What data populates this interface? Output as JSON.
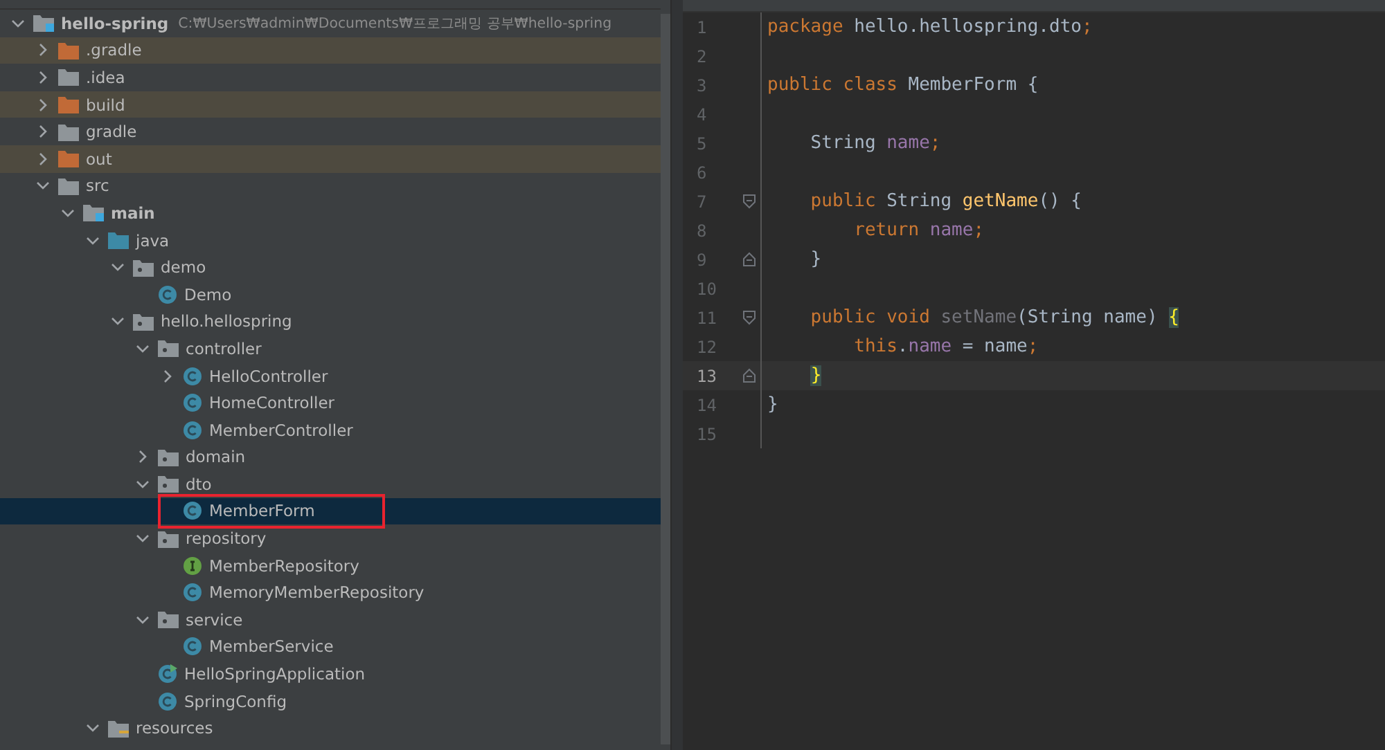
{
  "project_tree": [
    {
      "name": "hello-spring",
      "kind": "project",
      "path": "C:₩Users₩admin₩Documents₩프로그래밍 공부₩hello-spring",
      "expanded": true,
      "selected": false,
      "children": [
        {
          "name": ".gradle",
          "kind": "excluded",
          "expanded": false,
          "selected": false
        },
        {
          "name": ".idea",
          "kind": "folder",
          "expanded": false,
          "selected": false
        },
        {
          "name": "build",
          "kind": "excluded",
          "expanded": false,
          "selected": false
        },
        {
          "name": "gradle",
          "kind": "folder",
          "expanded": false,
          "selected": false
        },
        {
          "name": "out",
          "kind": "excluded",
          "expanded": false,
          "selected": false
        },
        {
          "name": "src",
          "kind": "folder",
          "expanded": true,
          "selected": false,
          "children": [
            {
              "name": "main",
              "kind": "module",
              "expanded": true,
              "selected": false,
              "children": [
                {
                  "name": "java",
                  "kind": "source",
                  "expanded": true,
                  "selected": false,
                  "children": [
                    {
                      "name": "demo",
                      "kind": "package",
                      "expanded": true,
                      "selected": false,
                      "children": [
                        {
                          "name": "Demo",
                          "kind": "class",
                          "selected": false
                        }
                      ]
                    },
                    {
                      "name": "hello.hellospring",
                      "kind": "package",
                      "expanded": true,
                      "selected": false,
                      "children": [
                        {
                          "name": "controller",
                          "kind": "package",
                          "expanded": true,
                          "selected": false,
                          "children": [
                            {
                              "name": "HelloController",
                              "kind": "class",
                              "expanded": false,
                              "selected": false
                            },
                            {
                              "name": "HomeController",
                              "kind": "class",
                              "selected": false
                            },
                            {
                              "name": "MemberController",
                              "kind": "class",
                              "selected": false
                            }
                          ]
                        },
                        {
                          "name": "domain",
                          "kind": "package",
                          "expanded": false,
                          "selected": false
                        },
                        {
                          "name": "dto",
                          "kind": "package",
                          "expanded": true,
                          "selected": false,
                          "children": [
                            {
                              "name": "MemberForm",
                              "kind": "class",
                              "selected": true,
                              "boxed": true
                            }
                          ]
                        },
                        {
                          "name": "repository",
                          "kind": "package",
                          "expanded": true,
                          "selected": false,
                          "children": [
                            {
                              "name": "MemberRepository",
                              "kind": "interface",
                              "selected": false
                            },
                            {
                              "name": "MemoryMemberRepository",
                              "kind": "class",
                              "selected": false
                            }
                          ]
                        },
                        {
                          "name": "service",
                          "kind": "package",
                          "expanded": true,
                          "selected": false,
                          "children": [
                            {
                              "name": "MemberService",
                              "kind": "class",
                              "selected": false
                            }
                          ]
                        },
                        {
                          "name": "HelloSpringApplication",
                          "kind": "app",
                          "selected": false
                        },
                        {
                          "name": "SpringConfig",
                          "kind": "class",
                          "selected": false
                        }
                      ]
                    }
                  ]
                },
                {
                  "name": "resources",
                  "kind": "resources",
                  "expanded": true,
                  "selected": false
                }
              ]
            }
          ]
        }
      ]
    }
  ],
  "editor": {
    "lines": [
      {
        "number": "1",
        "current": false,
        "kind": "plain",
        "tokens": [
          {
            "t": "package ",
            "kind": "kw"
          },
          {
            "t": "hello.hellospring.dto",
            "kind": "plain"
          },
          {
            "t": ";",
            "kind": "kw"
          }
        ]
      },
      {
        "number": "2",
        "current": false,
        "kind": "plain"
      },
      {
        "number": "3",
        "current": false,
        "kind": "plain",
        "tokens": [
          {
            "t": "public class ",
            "kind": "kw"
          },
          {
            "t": "MemberForm {",
            "kind": "plain"
          }
        ]
      },
      {
        "number": "4",
        "current": false,
        "kind": "plain"
      },
      {
        "number": "5",
        "current": false,
        "kind": "plain",
        "tokens": [
          {
            "t": "    String ",
            "kind": "plain"
          },
          {
            "t": "name",
            "kind": "field"
          },
          {
            "t": ";",
            "kind": "kw"
          }
        ]
      },
      {
        "number": "6",
        "current": false,
        "kind": "plain"
      },
      {
        "number": "7",
        "current": false,
        "kind": "fold_start",
        "tokens": [
          {
            "t": "    public ",
            "kind": "kw"
          },
          {
            "t": "String ",
            "kind": "plain"
          },
          {
            "t": "getName",
            "kind": "method"
          },
          {
            "t": "() {",
            "kind": "plain"
          }
        ]
      },
      {
        "number": "8",
        "current": false,
        "kind": "plain",
        "tokens": [
          {
            "t": "        return ",
            "kind": "kw"
          },
          {
            "t": "name",
            "kind": "field"
          },
          {
            "t": ";",
            "kind": "kw"
          }
        ]
      },
      {
        "number": "9",
        "current": false,
        "kind": "fold_end",
        "tokens": [
          {
            "t": "    }",
            "kind": "plain"
          }
        ]
      },
      {
        "number": "10",
        "current": false,
        "kind": "plain"
      },
      {
        "number": "11",
        "current": false,
        "kind": "fold_start",
        "tokens": [
          {
            "t": "    public void ",
            "kind": "kw"
          },
          {
            "t": "setName",
            "kind": "unused"
          },
          {
            "t": "(String name) ",
            "kind": "plain"
          },
          {
            "t": "{",
            "kind": "match"
          }
        ]
      },
      {
        "number": "12",
        "current": false,
        "kind": "plain",
        "tokens": [
          {
            "t": "        this",
            "kind": "kw"
          },
          {
            "t": ".",
            "kind": "plain"
          },
          {
            "t": "name",
            "kind": "field"
          },
          {
            "t": " = name",
            "kind": "plain"
          },
          {
            "t": ";",
            "kind": "kw"
          }
        ]
      },
      {
        "number": "13",
        "current": true,
        "kind": "fold_end",
        "tokens": [
          {
            "t": "    }",
            "kind": "match"
          }
        ]
      },
      {
        "number": "14",
        "current": false,
        "kind": "plain",
        "tokens": [
          {
            "t": "}",
            "kind": "plain"
          }
        ]
      },
      {
        "number": "15",
        "current": false,
        "kind": "plain"
      }
    ]
  }
}
